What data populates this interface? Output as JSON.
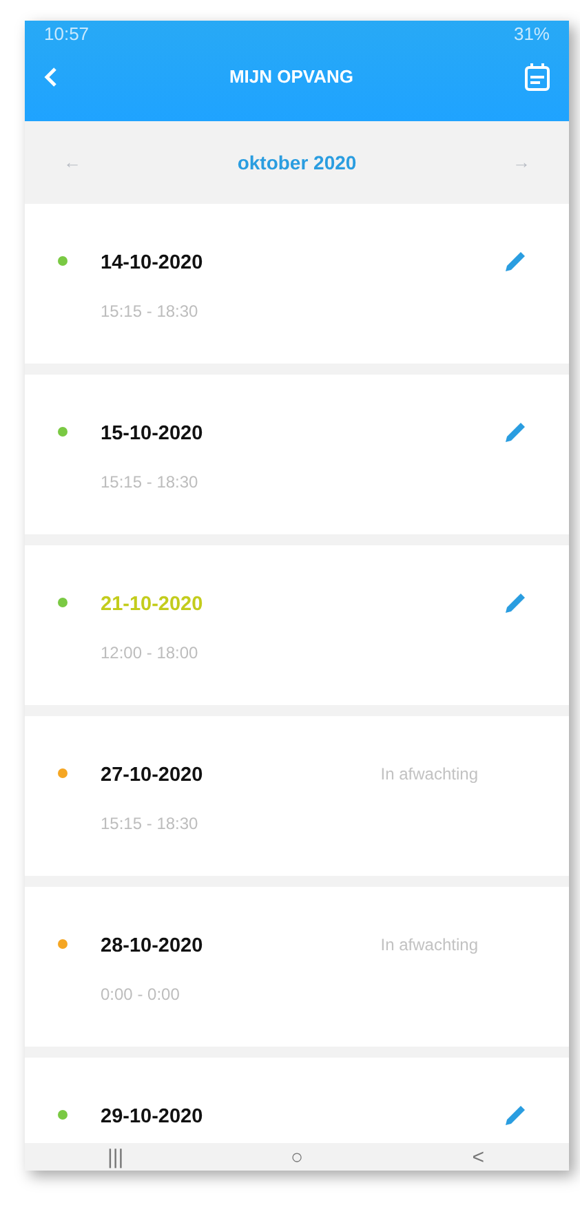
{
  "status_bar": {
    "time": "10:57",
    "battery": "31%"
  },
  "header": {
    "title": "MIJN OPVANG"
  },
  "month_bar": {
    "prev": "←",
    "month": "oktober 2020",
    "next": "→"
  },
  "entries": [
    {
      "date": "14-10-2020",
      "time": "15:15 - 18:30",
      "color": "#7ac943",
      "highlighted": false,
      "kind": "edit"
    },
    {
      "date": "15-10-2020",
      "time": "15:15 - 18:30",
      "color": "#7ac943",
      "highlighted": false,
      "kind": "edit"
    },
    {
      "date": "21-10-2020",
      "time": "12:00 - 18:00",
      "color": "#7ac943",
      "highlighted": true,
      "kind": "edit"
    },
    {
      "date": "27-10-2020",
      "time": "15:15 - 18:30",
      "color": "#f5a623",
      "highlighted": false,
      "kind": "status",
      "status": "In afwachting"
    },
    {
      "date": "28-10-2020",
      "time": "0:00 - 0:00",
      "color": "#f5a623",
      "highlighted": false,
      "kind": "status",
      "status": "In afwachting"
    },
    {
      "date": "29-10-2020",
      "color": "#7ac943",
      "highlighted": false,
      "kind": "edit"
    }
  ],
  "nav_bar": {
    "recent": "|||",
    "home": "○",
    "back": "<"
  }
}
